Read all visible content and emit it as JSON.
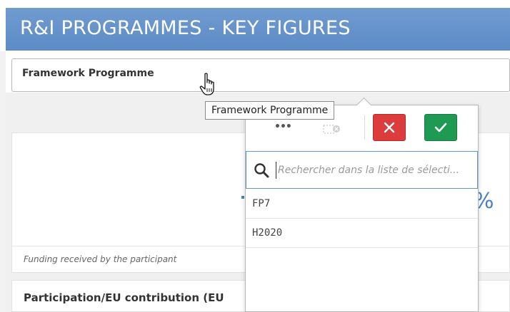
{
  "header": {
    "title": "R&I PROGRAMMES - KEY FIGURES",
    "background": "#5d8bc6"
  },
  "filter": {
    "label": "Framework Programme"
  },
  "tooltip": {
    "text": "Framework Programme"
  },
  "kpi_card": {
    "value_suffix": "%",
    "footnote": "Funding received by the participant"
  },
  "card2": {
    "title": "Participation/EU contribution (EU"
  },
  "popup": {
    "toolbar": {
      "more_icon": "more-options-icon",
      "clear_icon": "clear-selections-icon",
      "cancel_icon": "close-icon",
      "confirm_icon": "check-icon",
      "cancel_color": "#dc3c3c",
      "confirm_color": "#1f9a52"
    },
    "search": {
      "placeholder": "Rechercher dans la liste de sélecti..."
    },
    "items": [
      {
        "label": "FP7"
      },
      {
        "label": "H2020"
      }
    ]
  }
}
